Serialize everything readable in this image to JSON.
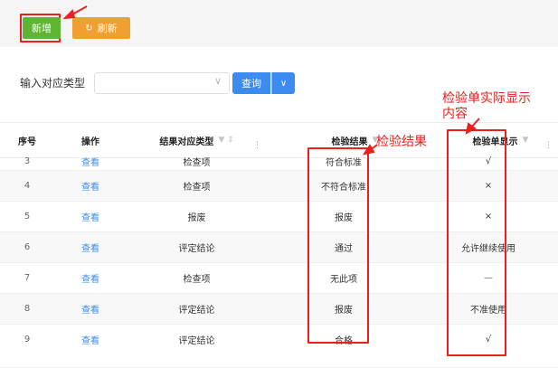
{
  "toolbar": {
    "add_label": "新增",
    "refresh_label": "刷新",
    "refresh_icon": "↻"
  },
  "filter": {
    "label": "输入对应类型",
    "select_value": "",
    "chevron": "∨",
    "query_label": "查询",
    "query_dropdown_icon": "∨"
  },
  "table": {
    "columns": [
      {
        "label": "序号",
        "filter": "",
        "dots": ""
      },
      {
        "label": "操作",
        "filter": "",
        "dots": ""
      },
      {
        "label": "结果对应类型",
        "filter": "▼ ⇕",
        "dots": "⋮"
      },
      {
        "label": "检验结果",
        "filter": "▼",
        "dots": ""
      },
      {
        "label": "检验单显示",
        "filter": "▼",
        "dots": "⋮"
      }
    ],
    "rows": [
      {
        "index": "3",
        "action": "查看",
        "type": "检查项",
        "result": "符合标准",
        "display": "√"
      },
      {
        "index": "4",
        "action": "查看",
        "type": "检查项",
        "result": "不符合标准",
        "display": "×"
      },
      {
        "index": "5",
        "action": "查看",
        "type": "报废",
        "result": "报废",
        "display": "×"
      },
      {
        "index": "6",
        "action": "查看",
        "type": "评定结论",
        "result": "通过",
        "display": "允许继续使用"
      },
      {
        "index": "7",
        "action": "查看",
        "type": "检查项",
        "result": "无此项",
        "display": "—"
      },
      {
        "index": "8",
        "action": "查看",
        "type": "评定结论",
        "result": "报废",
        "display": "不准使用"
      },
      {
        "index": "9",
        "action": "查看",
        "type": "评定结论",
        "result": "合格",
        "display": "√"
      }
    ]
  },
  "annotations": {
    "result_label": "检验结果",
    "display_label_line1": "检验单实际显示",
    "display_label_line2": "内容",
    "color": "#e8211d"
  },
  "colors": {
    "add_button": "#5eb532",
    "refresh_button": "#f0a030",
    "query_button": "#3c8bf0",
    "link": "#3c8bf0"
  }
}
